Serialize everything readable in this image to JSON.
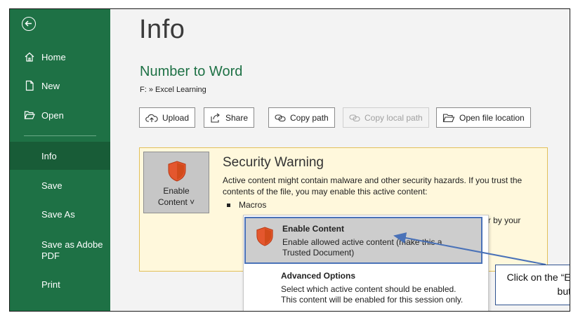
{
  "sidebar": {
    "items": [
      {
        "label": "Home",
        "icon": "home-icon"
      },
      {
        "label": "New",
        "icon": "new-document-icon"
      },
      {
        "label": "Open",
        "icon": "folder-open-icon"
      },
      {
        "label": "Info",
        "active": true
      },
      {
        "label": "Save"
      },
      {
        "label": "Save As"
      },
      {
        "label": "Save as Adobe PDF"
      },
      {
        "label": "Print"
      }
    ]
  },
  "main": {
    "page_title": "Info",
    "doc_title": "Number to Word",
    "doc_path": "F: » Excel Learning",
    "toolbar": {
      "upload": "Upload",
      "share": "Share",
      "copy_path": "Copy path",
      "copy_local_path": "Copy local path",
      "open_file_location": "Open file location"
    }
  },
  "security": {
    "enable_button_line1": "Enable",
    "enable_button_line2": "Content ˅",
    "title": "Security Warning",
    "text": "Active content might contain malware and other security hazards. If you trust the contents of the file, you may enable this active content:",
    "bullet": "Macros",
    "more_text": "e disabled in Trust Center or by your"
  },
  "dropdown": {
    "enable_title": "Enable Content",
    "enable_desc": "Enable allowed active content (make this a Trusted Document)",
    "advanced_title": "Advanced Options",
    "advanced_desc": "Select which active content should be enabled. This content will be enabled for this session only."
  },
  "callout": {
    "text": "Click on the “Enable Content” button"
  },
  "colors": {
    "sidebar": "#1e7145",
    "sidebar_active": "#185c37",
    "warning_bg": "#fff8dc",
    "shield": "#d9481c",
    "callout_border": "#2f528f"
  }
}
